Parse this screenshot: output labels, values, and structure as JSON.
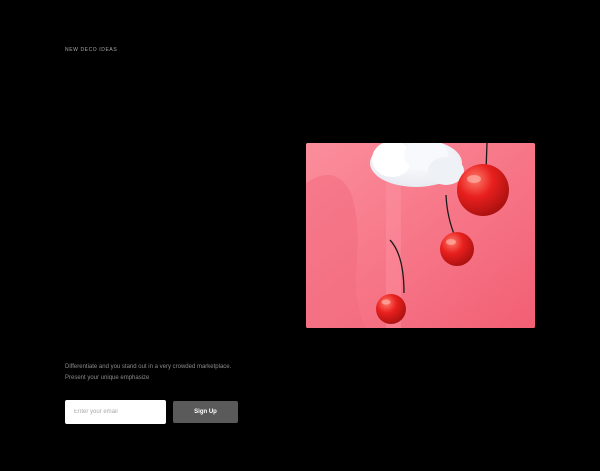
{
  "hero": {
    "eyebrow": "NEW DECO IDEAS"
  },
  "content": {
    "description": "Differentiate and you stand out in a very crowded marketplace. Present your unique emphasize"
  },
  "signup": {
    "email_placeholder": "Enter your email",
    "button_label": "Sign Up"
  },
  "colors": {
    "background": "#000000",
    "button": "#5a5a5a",
    "image_pink": "#f57a8a",
    "cherry_red": "#e8201e"
  }
}
